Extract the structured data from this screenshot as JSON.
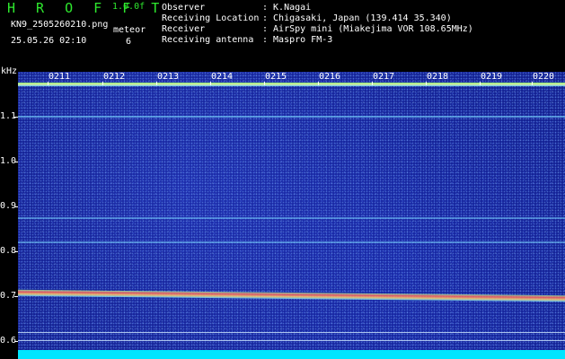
{
  "header": {
    "app_title": "H R O F F T",
    "version": "1.0.0f",
    "filename": "KN9_2505260210.png",
    "mode": "meteor",
    "datetime": "25.05.26 02:10",
    "count": "6"
  },
  "meta": [
    {
      "key": "Observer",
      "value": ": K.Nagai"
    },
    {
      "key": "Receiving Location",
      "value": ": Chigasaki, Japan (139.414 35.340)"
    },
    {
      "key": "Receiver",
      "value": ": AirSpy mini (Miakejima VOR 108.65MHz)"
    },
    {
      "key": "Receiving antenna",
      "value": ": Maspro FM-3"
    }
  ],
  "axis": {
    "unit": "kHz",
    "y_ticks": [
      "1.1",
      "1.0",
      "0.9",
      "0.8",
      "0.7",
      "0.6"
    ],
    "x_ticks": [
      "0211",
      "0212",
      "0213",
      "0214",
      "0215",
      "0216",
      "0217",
      "0218",
      "0219",
      "0220"
    ]
  },
  "colors": {
    "background": "#000000",
    "plot_noise": "#13208f",
    "title": "#2ee82e",
    "signal": "#ff5a5a",
    "bottom_band": "#00e5ff"
  }
}
